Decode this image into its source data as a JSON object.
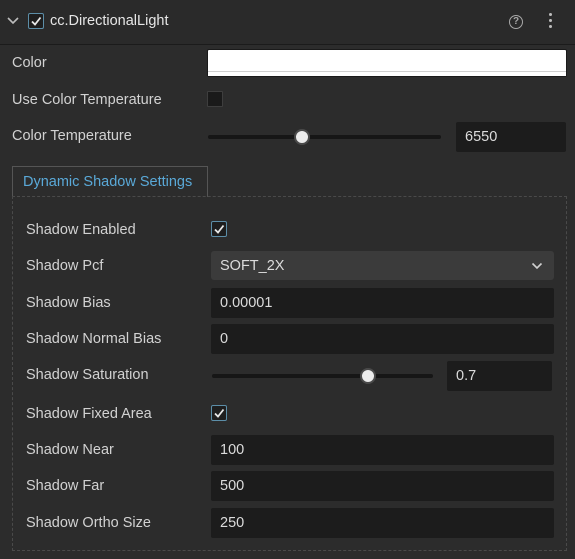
{
  "component": {
    "title": "cc.DirectionalLight",
    "enabled": true
  },
  "props": {
    "color_label": "Color",
    "use_color_temp_label": "Use Color Temperature",
    "use_color_temp_checked": false,
    "color_temp_label": "Color Temperature",
    "color_temp_value": "6550"
  },
  "tab": {
    "label": "Dynamic Shadow Settings"
  },
  "shadow": {
    "enabled_label": "Shadow Enabled",
    "enabled_checked": true,
    "pcf_label": "Shadow Pcf",
    "pcf_value": "SOFT_2X",
    "bias_label": "Shadow Bias",
    "bias_value": "0.00001",
    "normal_bias_label": "Shadow Normal Bias",
    "normal_bias_value": "0",
    "saturation_label": "Shadow Saturation",
    "saturation_value": "0.7",
    "fixed_area_label": "Shadow Fixed Area",
    "fixed_area_checked": true,
    "near_label": "Shadow Near",
    "near_value": "100",
    "far_label": "Shadow Far",
    "far_value": "500",
    "ortho_label": "Shadow Ortho Size",
    "ortho_value": "250"
  },
  "icons": {
    "collapse": "chevron-down-icon",
    "help": "help-circle-icon",
    "more": "more-vertical-icon",
    "dropdown": "chevron-down-icon"
  },
  "colors": {
    "accent": "#5aa9d8",
    "background": "#2c2c2c",
    "field": "#1c1c1c",
    "color_swatch": "#ffffff"
  }
}
